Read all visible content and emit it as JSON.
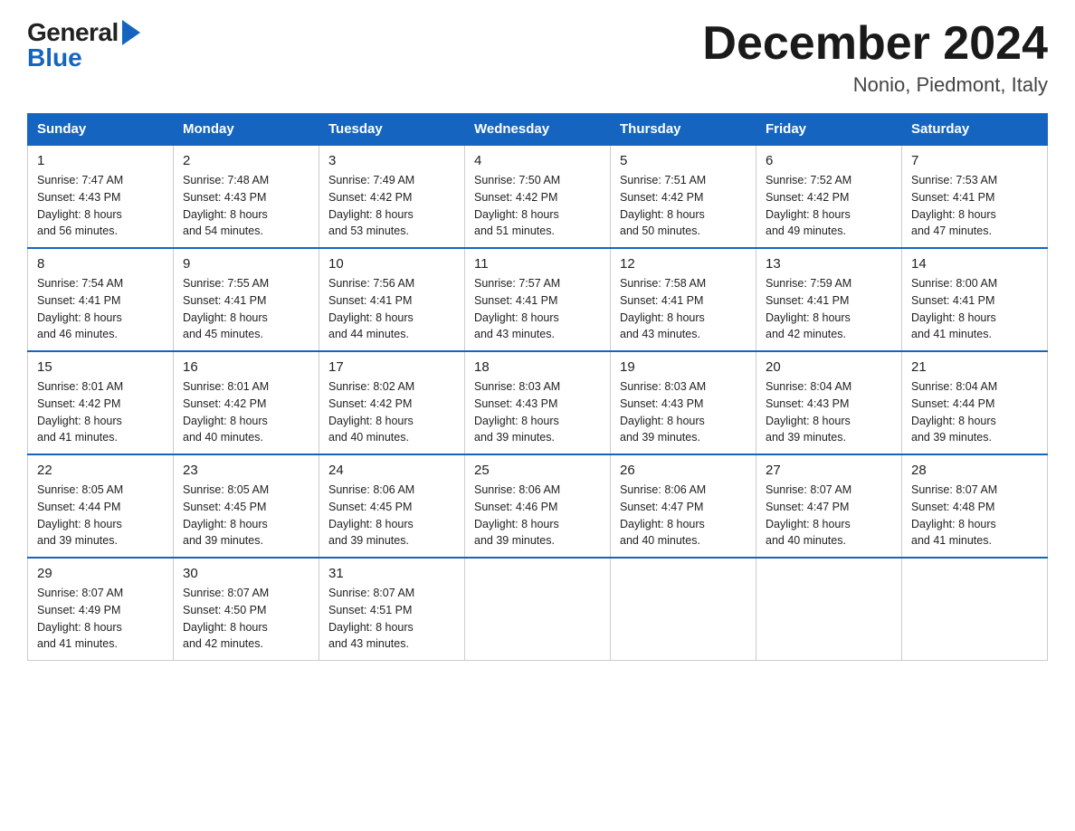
{
  "header": {
    "month_title": "December 2024",
    "location": "Nonio, Piedmont, Italy",
    "logo_general": "General",
    "logo_blue": "Blue"
  },
  "days_of_week": [
    "Sunday",
    "Monday",
    "Tuesday",
    "Wednesday",
    "Thursday",
    "Friday",
    "Saturday"
  ],
  "weeks": [
    [
      {
        "day": "1",
        "info": "Sunrise: 7:47 AM\nSunset: 4:43 PM\nDaylight: 8 hours\nand 56 minutes."
      },
      {
        "day": "2",
        "info": "Sunrise: 7:48 AM\nSunset: 4:43 PM\nDaylight: 8 hours\nand 54 minutes."
      },
      {
        "day": "3",
        "info": "Sunrise: 7:49 AM\nSunset: 4:42 PM\nDaylight: 8 hours\nand 53 minutes."
      },
      {
        "day": "4",
        "info": "Sunrise: 7:50 AM\nSunset: 4:42 PM\nDaylight: 8 hours\nand 51 minutes."
      },
      {
        "day": "5",
        "info": "Sunrise: 7:51 AM\nSunset: 4:42 PM\nDaylight: 8 hours\nand 50 minutes."
      },
      {
        "day": "6",
        "info": "Sunrise: 7:52 AM\nSunset: 4:42 PM\nDaylight: 8 hours\nand 49 minutes."
      },
      {
        "day": "7",
        "info": "Sunrise: 7:53 AM\nSunset: 4:41 PM\nDaylight: 8 hours\nand 47 minutes."
      }
    ],
    [
      {
        "day": "8",
        "info": "Sunrise: 7:54 AM\nSunset: 4:41 PM\nDaylight: 8 hours\nand 46 minutes."
      },
      {
        "day": "9",
        "info": "Sunrise: 7:55 AM\nSunset: 4:41 PM\nDaylight: 8 hours\nand 45 minutes."
      },
      {
        "day": "10",
        "info": "Sunrise: 7:56 AM\nSunset: 4:41 PM\nDaylight: 8 hours\nand 44 minutes."
      },
      {
        "day": "11",
        "info": "Sunrise: 7:57 AM\nSunset: 4:41 PM\nDaylight: 8 hours\nand 43 minutes."
      },
      {
        "day": "12",
        "info": "Sunrise: 7:58 AM\nSunset: 4:41 PM\nDaylight: 8 hours\nand 43 minutes."
      },
      {
        "day": "13",
        "info": "Sunrise: 7:59 AM\nSunset: 4:41 PM\nDaylight: 8 hours\nand 42 minutes."
      },
      {
        "day": "14",
        "info": "Sunrise: 8:00 AM\nSunset: 4:41 PM\nDaylight: 8 hours\nand 41 minutes."
      }
    ],
    [
      {
        "day": "15",
        "info": "Sunrise: 8:01 AM\nSunset: 4:42 PM\nDaylight: 8 hours\nand 41 minutes."
      },
      {
        "day": "16",
        "info": "Sunrise: 8:01 AM\nSunset: 4:42 PM\nDaylight: 8 hours\nand 40 minutes."
      },
      {
        "day": "17",
        "info": "Sunrise: 8:02 AM\nSunset: 4:42 PM\nDaylight: 8 hours\nand 40 minutes."
      },
      {
        "day": "18",
        "info": "Sunrise: 8:03 AM\nSunset: 4:43 PM\nDaylight: 8 hours\nand 39 minutes."
      },
      {
        "day": "19",
        "info": "Sunrise: 8:03 AM\nSunset: 4:43 PM\nDaylight: 8 hours\nand 39 minutes."
      },
      {
        "day": "20",
        "info": "Sunrise: 8:04 AM\nSunset: 4:43 PM\nDaylight: 8 hours\nand 39 minutes."
      },
      {
        "day": "21",
        "info": "Sunrise: 8:04 AM\nSunset: 4:44 PM\nDaylight: 8 hours\nand 39 minutes."
      }
    ],
    [
      {
        "day": "22",
        "info": "Sunrise: 8:05 AM\nSunset: 4:44 PM\nDaylight: 8 hours\nand 39 minutes."
      },
      {
        "day": "23",
        "info": "Sunrise: 8:05 AM\nSunset: 4:45 PM\nDaylight: 8 hours\nand 39 minutes."
      },
      {
        "day": "24",
        "info": "Sunrise: 8:06 AM\nSunset: 4:45 PM\nDaylight: 8 hours\nand 39 minutes."
      },
      {
        "day": "25",
        "info": "Sunrise: 8:06 AM\nSunset: 4:46 PM\nDaylight: 8 hours\nand 39 minutes."
      },
      {
        "day": "26",
        "info": "Sunrise: 8:06 AM\nSunset: 4:47 PM\nDaylight: 8 hours\nand 40 minutes."
      },
      {
        "day": "27",
        "info": "Sunrise: 8:07 AM\nSunset: 4:47 PM\nDaylight: 8 hours\nand 40 minutes."
      },
      {
        "day": "28",
        "info": "Sunrise: 8:07 AM\nSunset: 4:48 PM\nDaylight: 8 hours\nand 41 minutes."
      }
    ],
    [
      {
        "day": "29",
        "info": "Sunrise: 8:07 AM\nSunset: 4:49 PM\nDaylight: 8 hours\nand 41 minutes."
      },
      {
        "day": "30",
        "info": "Sunrise: 8:07 AM\nSunset: 4:50 PM\nDaylight: 8 hours\nand 42 minutes."
      },
      {
        "day": "31",
        "info": "Sunrise: 8:07 AM\nSunset: 4:51 PM\nDaylight: 8 hours\nand 43 minutes."
      },
      {
        "day": "",
        "info": ""
      },
      {
        "day": "",
        "info": ""
      },
      {
        "day": "",
        "info": ""
      },
      {
        "day": "",
        "info": ""
      }
    ]
  ]
}
